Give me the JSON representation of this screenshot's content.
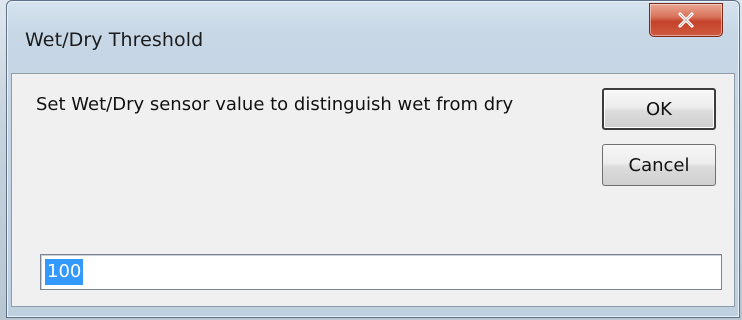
{
  "window": {
    "title": "Wet/Dry Threshold",
    "close_icon": "close-icon"
  },
  "dialog": {
    "message": "Set Wet/Dry sensor value to distinguish wet from dry",
    "ok_label": "OK",
    "cancel_label": "Cancel",
    "threshold_value": "100"
  },
  "colors": {
    "close_button": "#c4432a",
    "selection": "#3399ff",
    "client_bg": "#f0f0f0"
  }
}
